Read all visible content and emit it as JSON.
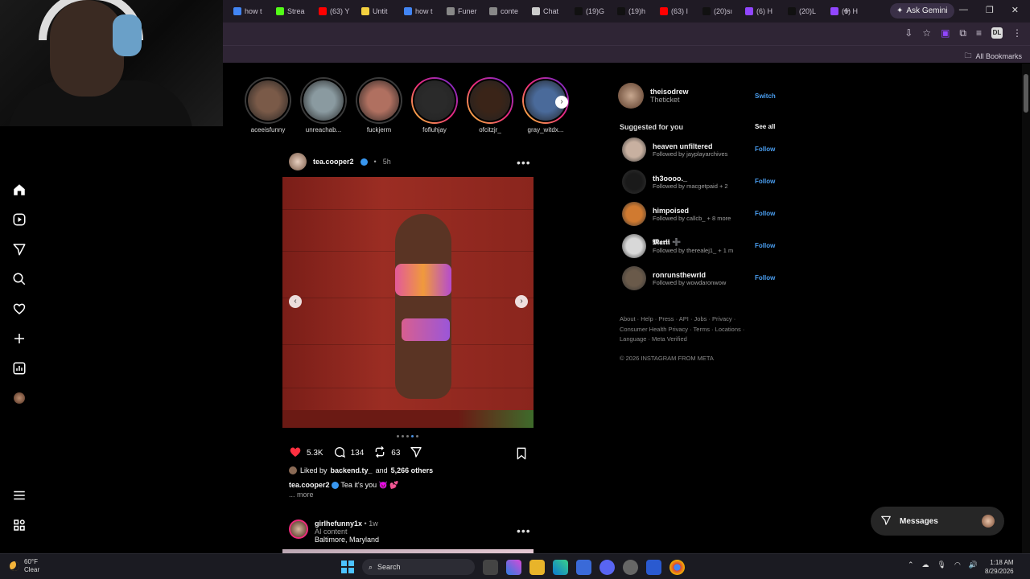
{
  "browser": {
    "tabs": [
      {
        "label": "how t",
        "fav_color": "#4285f4",
        "icon": "google-icon"
      },
      {
        "label": "Strea",
        "fav_color": "#53fc18",
        "icon": "kick-icon"
      },
      {
        "label": "(63) Y",
        "fav_color": "#ff0000",
        "icon": "youtube-icon"
      },
      {
        "label": "Untit",
        "fav_color": "#f4d03f",
        "icon": "docs-icon"
      },
      {
        "label": "how t",
        "fav_color": "#4285f4",
        "icon": "google-icon"
      },
      {
        "label": "Funer",
        "fav_color": "#888888",
        "icon": "page-icon"
      },
      {
        "label": "conte",
        "fav_color": "#888888",
        "icon": "page-icon"
      },
      {
        "label": "Chat",
        "fav_color": "#cccccc",
        "icon": "chatgpt-icon"
      },
      {
        "label": "(19)G",
        "fav_color": "#111111",
        "icon": "tiktok-icon"
      },
      {
        "label": "(19)h",
        "fav_color": "#111111",
        "icon": "tiktok-icon"
      },
      {
        "label": "(63) I",
        "fav_color": "#ff0000",
        "icon": "youtube-icon"
      },
      {
        "label": "(20)sı",
        "fav_color": "#111111",
        "icon": "tiktok-icon"
      },
      {
        "label": "(6) H",
        "fav_color": "#9146ff",
        "icon": "twitch-icon"
      },
      {
        "label": "(20)L",
        "fav_color": "#111111",
        "icon": "tiktok-icon"
      },
      {
        "label": "(6) H",
        "fav_color": "#9146ff",
        "icon": "twitch-icon"
      }
    ],
    "ask_gemini": "Ask Gemini",
    "all_bookmarks": "All Bookmarks",
    "profile_badge": "DL"
  },
  "stories": [
    {
      "name": "aceeisfunny",
      "new": false,
      "color": "#7a5a48"
    },
    {
      "name": "unreachab...",
      "new": false,
      "color": "#8a9aa0"
    },
    {
      "name": "fuckjerm",
      "new": false,
      "color": "#b07060"
    },
    {
      "name": "fofluhjay",
      "new": true,
      "color": "#2a2a2a"
    },
    {
      "name": "ofcitzjr_",
      "new": true,
      "color": "#3a2418"
    },
    {
      "name": "gray_witdx...",
      "new": true,
      "color": "#4a6a9a"
    }
  ],
  "post": {
    "username": "tea.cooper2",
    "time": "5h",
    "likes": "5.3K",
    "comments": "134",
    "reposts": "63",
    "liked_by_prefix": "Liked by",
    "liked_by_user": "backend.ty_",
    "liked_by_and": "and",
    "liked_by_others": "5,266 others",
    "caption_user": "tea.cooper2",
    "caption_text": "Tea it's you 😈 💕",
    "more": "... more",
    "carousel_total": 5,
    "carousel_index": 3
  },
  "post2": {
    "username": "girlhefunny1x",
    "time": "1w",
    "label": "AI content",
    "location": "Baltimore, Maryland"
  },
  "right": {
    "me_username": "theisodrew",
    "me_name": "Theticket",
    "switch": "Switch",
    "suggested_title": "Suggested for you",
    "see_all": "See all",
    "suggestions": [
      {
        "name": "heaven unfiltered",
        "sub": "Followed by jayplayarchives",
        "color": "#c8b0a0"
      },
      {
        "name": "th3oooo._",
        "sub": "Followed by macgetpaid + 2",
        "color": "#1a1a1a"
      },
      {
        "name": "himpoised",
        "sub": "Followed by callcb_ + 8 more",
        "color": "#d07a30"
      },
      {
        "name": "𝕸𝖆𝖗𝖎𝖎 ➕",
        "sub": "Followed by therealej1_ + 1 m",
        "color": "#d8d8d8"
      },
      {
        "name": "ronrunsthewrld",
        "sub": "Followed by wowdaronwow",
        "color": "#6a5a4a"
      }
    ],
    "follow": "Follow",
    "footer": "About · Help · Press · API · Jobs · Privacy · Consumer Health Privacy · Terms · Locations · Language · Meta Verified",
    "copyright": "© 2026 INSTAGRAM FROM META"
  },
  "messages": "Messages",
  "taskbar": {
    "temp": "60°F",
    "condition": "Clear",
    "search": "Search",
    "time": "1:18 AM",
    "date": "8/29/2026"
  }
}
